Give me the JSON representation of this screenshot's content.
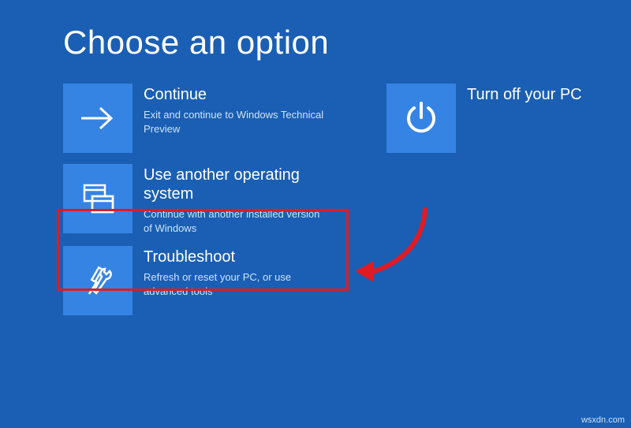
{
  "title": "Choose an option",
  "tiles": {
    "continue": {
      "label": "Continue",
      "desc": "Exit and continue to Windows Technical Preview"
    },
    "useAnother": {
      "label": "Use another operating system",
      "desc": "Continue with another installed version of Windows"
    },
    "troubleshoot": {
      "label": "Troubleshoot",
      "desc": "Refresh or reset your PC, or use advanced tools"
    },
    "turnOff": {
      "label": "Turn off your PC"
    }
  },
  "watermark": "wsxdn.com"
}
